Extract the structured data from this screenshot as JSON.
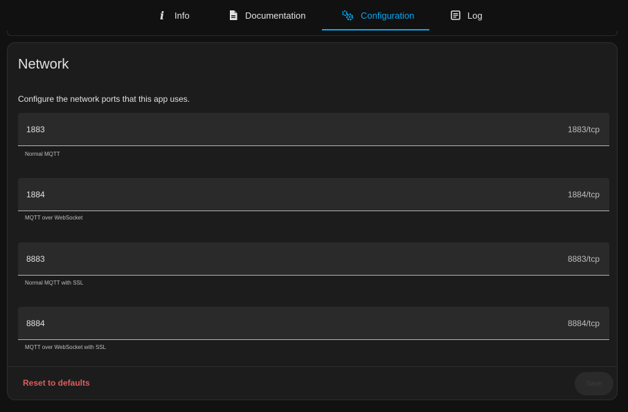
{
  "tabs": [
    {
      "label": "Info",
      "icon": "info-icon"
    },
    {
      "label": "Documentation",
      "icon": "document-icon"
    },
    {
      "label": "Configuration",
      "icon": "cogs-icon",
      "active": true
    },
    {
      "label": "Log",
      "icon": "log-icon"
    }
  ],
  "network": {
    "title": "Network",
    "description": "Configure the network ports that this app uses.",
    "fields": [
      {
        "value": "1883",
        "suffix": "1883/tcp",
        "helper": "Normal MQTT"
      },
      {
        "value": "1884",
        "suffix": "1884/tcp",
        "helper": "MQTT over WebSocket"
      },
      {
        "value": "8883",
        "suffix": "8883/tcp",
        "helper": "Normal MQTT with SSL"
      },
      {
        "value": "8884",
        "suffix": "8884/tcp",
        "helper": "MQTT over WebSocket with SSL"
      }
    ],
    "reset_label": "Reset to defaults",
    "save_label": "Save"
  },
  "colors": {
    "accent": "#03a9f4",
    "danger": "#e05c5c",
    "background": "#111111",
    "card": "#1c1c1c"
  }
}
